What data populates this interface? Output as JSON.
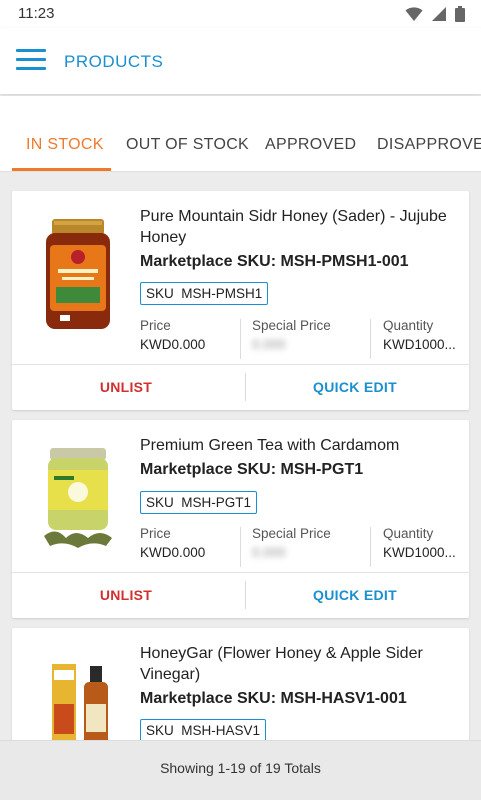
{
  "status_bar": {
    "time": "11:23",
    "icons": [
      "wifi-icon",
      "signal-icon",
      "battery-icon"
    ]
  },
  "header": {
    "title": "PRODUCTS",
    "menu_icon": "hamburger-menu-icon"
  },
  "tabs": [
    {
      "label": "IN STOCK",
      "active": true
    },
    {
      "label": "OUT OF STOCK",
      "active": false
    },
    {
      "label": "APPROVED",
      "active": false
    },
    {
      "label": "DISAPPROVED",
      "active": false
    }
  ],
  "columns": {
    "price": "Price",
    "special_price": "Special Price",
    "quantity": "Quantity"
  },
  "actions": {
    "unlist": "UNLIST",
    "quick_edit": "QUICK EDIT"
  },
  "products": [
    {
      "name": "Pure Mountain Sidr Honey (Sader) - Jujube Honey",
      "marketplace_sku": "Marketplace SKU: MSH-PMSH1-001",
      "sku_label": "SKU",
      "sku": "MSH-PMSH1",
      "price": "KWD0.000",
      "special_price": "0.000",
      "quantity": "KWD1000..."
    },
    {
      "name": "Premium Green Tea with Cardamom",
      "marketplace_sku": "Marketplace SKU: MSH-PGT1",
      "sku_label": "SKU",
      "sku": "MSH-PGT1",
      "price": "KWD0.000",
      "special_price": "0.000",
      "quantity": "KWD1000..."
    },
    {
      "name": "HoneyGar (Flower Honey & Apple Sider Vinegar)",
      "marketplace_sku": "Marketplace SKU: MSH-HASV1-001",
      "sku_label": "SKU",
      "sku": "MSH-HASV1"
    }
  ],
  "footer": {
    "summary": "Showing 1-19 of 19 Totals"
  },
  "colors": {
    "accent": "#1a8fd1",
    "tab_active": "#f07a2c",
    "unlist": "#d32f2f"
  }
}
